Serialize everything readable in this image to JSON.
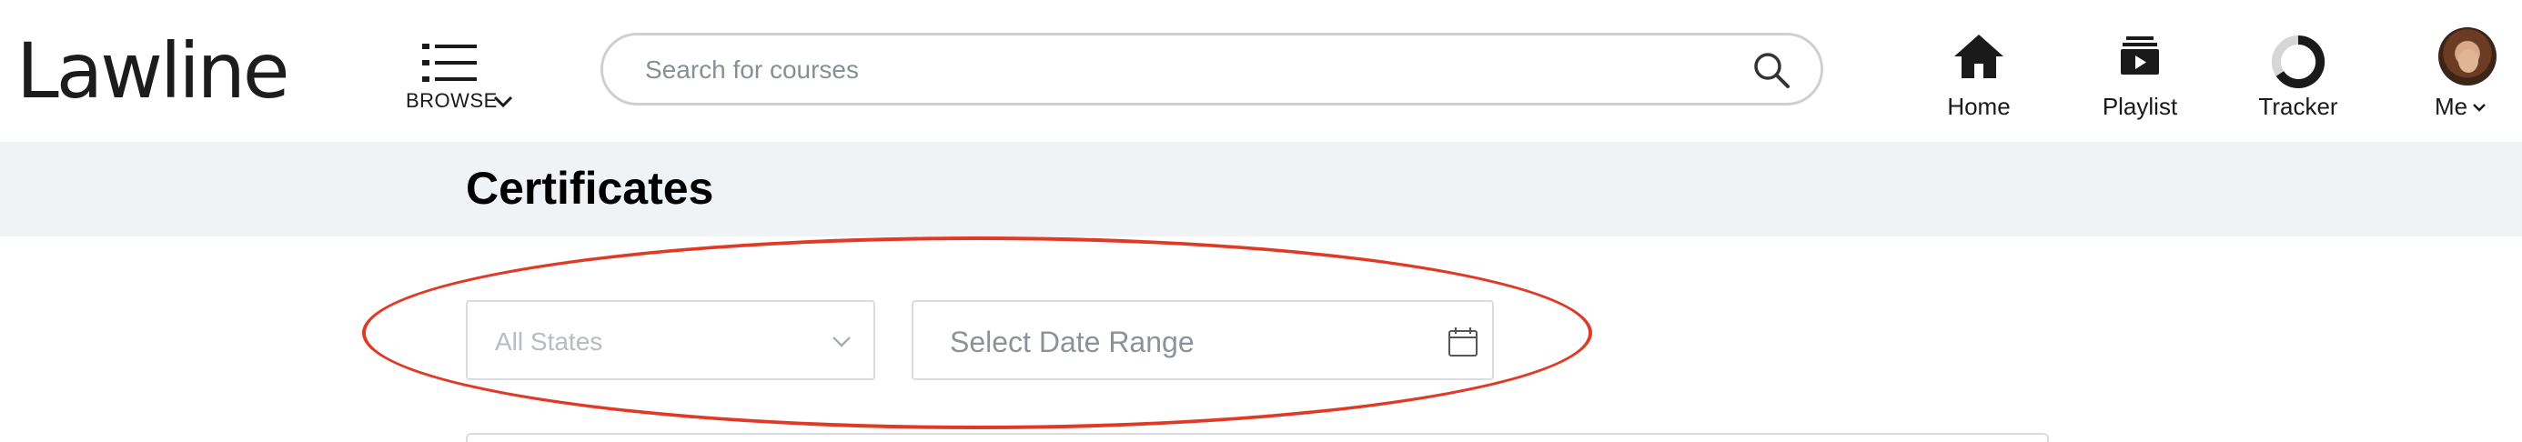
{
  "header": {
    "logo_text": "Lawline",
    "browse_label": "BROWSE",
    "search_placeholder": "Search for courses",
    "nav": [
      {
        "label": "Home",
        "icon": "home-icon"
      },
      {
        "label": "Playlist",
        "icon": "playlist-icon"
      },
      {
        "label": "Tracker",
        "icon": "tracker-icon"
      },
      {
        "label": "Me",
        "icon": "avatar"
      }
    ]
  },
  "page": {
    "title": "Certificates"
  },
  "filters": {
    "state_value": "All States",
    "date_placeholder": "Select Date Range"
  },
  "colors": {
    "brand_accent": "#1c8fb0",
    "annotation": "#e03a26",
    "title_band": "#f0f3f5"
  }
}
